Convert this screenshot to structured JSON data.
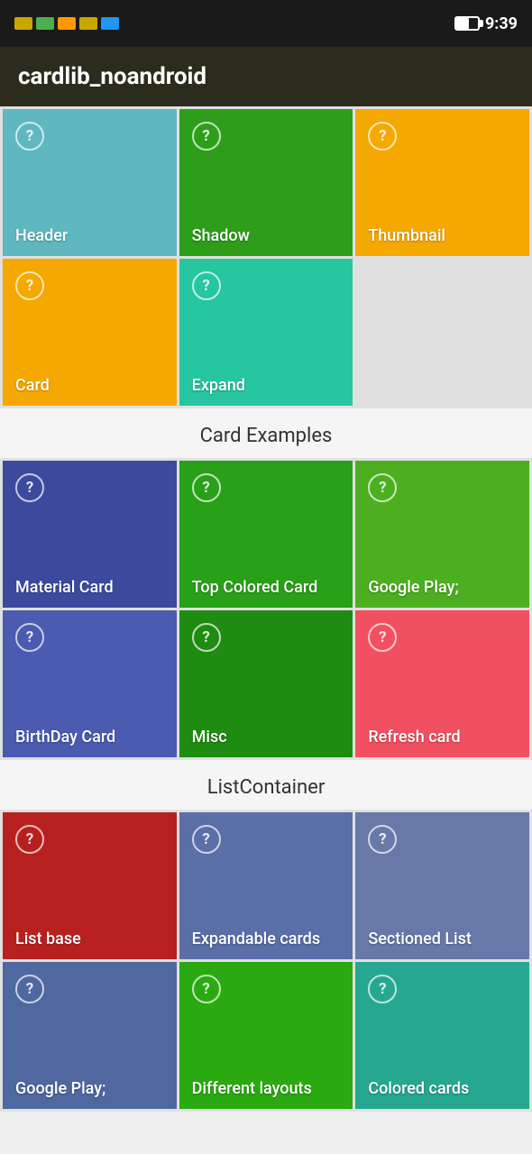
{
  "statusBar": {
    "time": "9:39"
  },
  "appBar": {
    "title": "cardlib_noandroid"
  },
  "sections": {
    "cardExamplesLabel": "Card Examples",
    "listContainerLabel": "ListContainer"
  },
  "topGrid": [
    {
      "id": "header",
      "label": "Header",
      "color": "teal"
    },
    {
      "id": "shadow",
      "label": "Shadow",
      "color": "green-dark"
    },
    {
      "id": "thumbnail",
      "label": "Thumbnail",
      "color": "amber"
    },
    {
      "id": "card",
      "label": "Card",
      "color": "amber2"
    },
    {
      "id": "expand",
      "label": "Expand",
      "color": "teal2"
    }
  ],
  "cardExamplesGrid": [
    {
      "id": "material-card",
      "label": "Material Card",
      "color": "blue-indigo"
    },
    {
      "id": "top-colored-card",
      "label": "Top Colored Card",
      "color": "green-mid"
    },
    {
      "id": "google-play",
      "label": "Google Play;",
      "color": "green-bright"
    },
    {
      "id": "birthday-card",
      "label": "BirthDay Card",
      "color": "blue-med"
    },
    {
      "id": "misc",
      "label": "Misc",
      "color": "green-dark2"
    },
    {
      "id": "refresh-card",
      "label": "Refresh card",
      "color": "pink-red"
    }
  ],
  "listContainerGrid": [
    {
      "id": "list-base",
      "label": "List base",
      "color": "red-dark"
    },
    {
      "id": "expandable-cards",
      "label": "Expandable cards",
      "color": "blue-slate"
    },
    {
      "id": "sectioned-list",
      "label": "Sectioned List",
      "color": "blue-slate2"
    },
    {
      "id": "google-play2",
      "label": "Google Play;",
      "color": "blue-slate3"
    },
    {
      "id": "different-layouts",
      "label": "Different layouts",
      "color": "green-lime"
    },
    {
      "id": "colored-cards",
      "label": "Colored cards",
      "color": "teal3"
    }
  ]
}
